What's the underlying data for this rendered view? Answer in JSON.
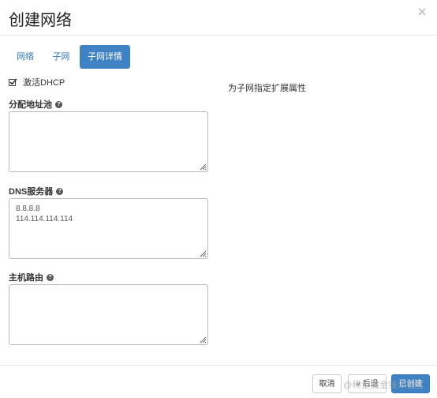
{
  "header": {
    "title": "创建网络",
    "close_glyph": "×"
  },
  "tabs": [
    {
      "label": "网络",
      "active": false
    },
    {
      "label": "子网",
      "active": false
    },
    {
      "label": "子网详情",
      "active": true
    }
  ],
  "dhcp": {
    "label": "激活DHCP",
    "checked": true
  },
  "hint": "为子网指定扩展属性",
  "fields": {
    "pools": {
      "label": "分配地址池",
      "value": ""
    },
    "dns": {
      "label": "DNS服务器",
      "value": "8.8.8.8\n114.114.114.114"
    },
    "routes": {
      "label": "主机路由",
      "value": ""
    }
  },
  "help_glyph": "?",
  "footer": {
    "cancel_label": "取消",
    "back_label": "« 后退",
    "create_label": "已创建"
  },
  "watermark": "@稀土掘金技术社区",
  "colors": {
    "primary": "#3e82c3",
    "link": "#337ab7",
    "border": "#b8b8b8"
  }
}
